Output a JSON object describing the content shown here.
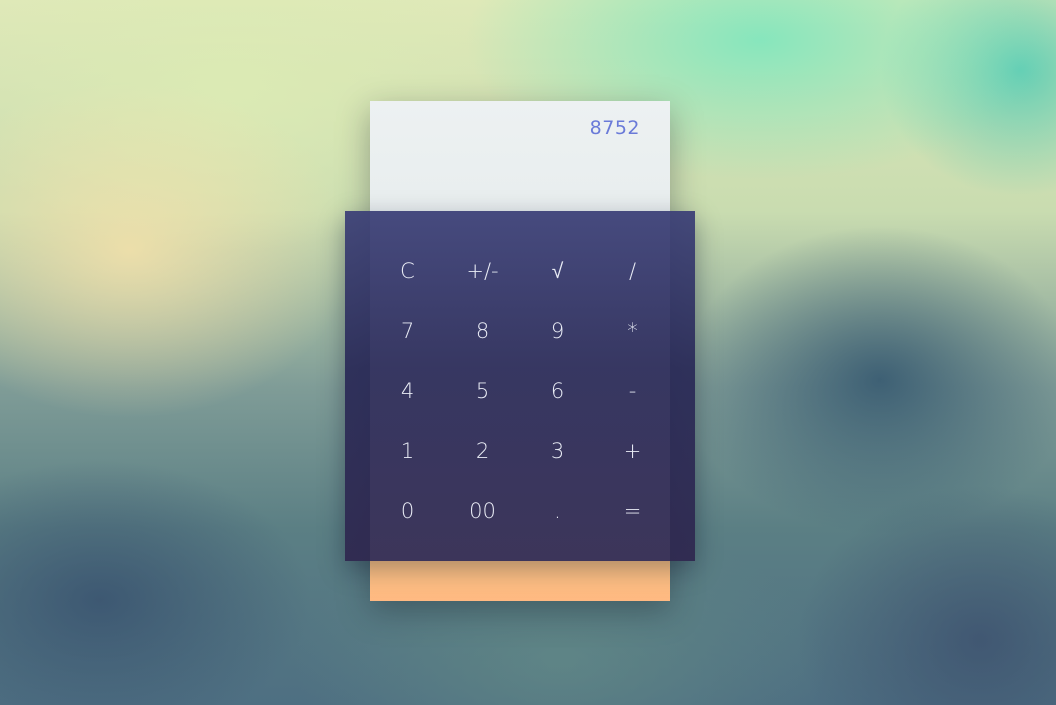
{
  "display": {
    "value": "8752"
  },
  "keys": {
    "clear": "C",
    "sign": "+/-",
    "sqrt": "√",
    "divide": "/",
    "seven": "7",
    "eight": "8",
    "nine": "9",
    "multiply": "*",
    "four": "4",
    "five": "5",
    "six": "6",
    "subtract": "-",
    "one": "1",
    "two": "2",
    "three": "3",
    "add": "+",
    "zero": "0",
    "double_zero": "00",
    "decimal": ".",
    "equals": "="
  },
  "colors": {
    "display_text": "#6a7ad8",
    "paper": "#e8eeee",
    "footer_accent": "#ffbd83",
    "keypad": "#35376e",
    "key_text": "#e9ecf5"
  }
}
